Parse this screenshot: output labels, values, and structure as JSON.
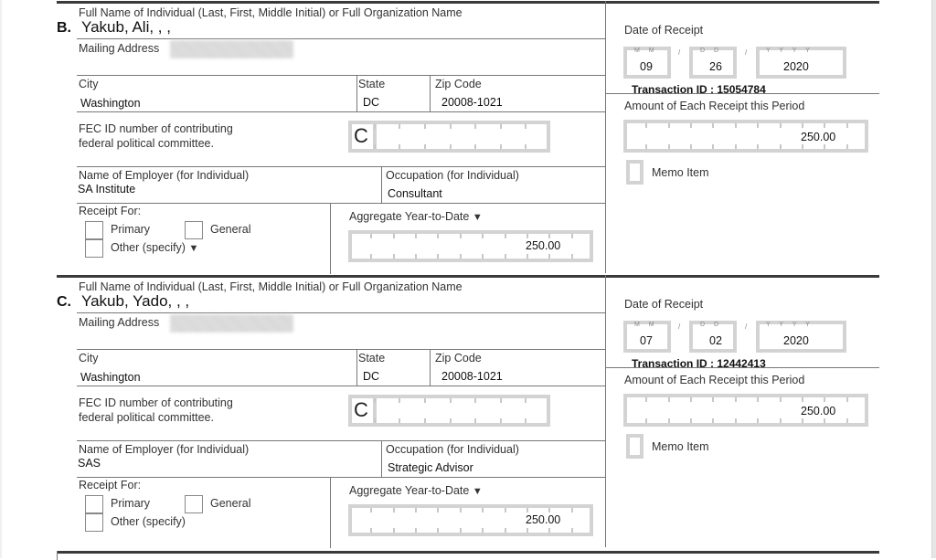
{
  "labels": {
    "full_name": "Full Name of Individual (Last, First, Middle Initial) or Full Organization Name",
    "mailing_address": "Mailing Address",
    "city": "City",
    "state": "State",
    "zip": "Zip Code",
    "fec_id_line1": "FEC ID number of contributing",
    "fec_id_line2": "federal political committee.",
    "fec_prefix": "C",
    "employer": "Name of Employer (for Individual)",
    "occupation": "Occupation (for Individual)",
    "receipt_for": "Receipt For:",
    "primary": "Primary",
    "general": "General",
    "other": "Other (specify)",
    "aggregate": "Aggregate Year-to-Date",
    "date_of_receipt": "Date of Receipt",
    "amount": "Amount of Each Receipt this Period",
    "memo_item": "Memo Item",
    "mm": "M M",
    "dd": "D D",
    "yyyy": "Y Y Y Y",
    "triangle": "▼"
  },
  "entries": [
    {
      "letter": "B.",
      "name": "Yakub, Ali, , ,",
      "mailing_address": "[redacted]",
      "city": "Washington",
      "state": "DC",
      "zip": "20008-1021",
      "employer": "SA Institute",
      "occupation": "Consultant",
      "aggregate": "250.00",
      "date": {
        "month": "09",
        "day": "26",
        "year": "2020"
      },
      "transaction_id": "Transaction ID : 15054784",
      "amount": "250.00",
      "other_has_triangle": true
    },
    {
      "letter": "C.",
      "name": "Yakub, Yado, , ,",
      "mailing_address": "[redacted]",
      "city": "Washington",
      "state": "DC",
      "zip": "20008-1021",
      "employer": "SAS",
      "occupation": "Strategic Advisor",
      "aggregate": "250.00",
      "date": {
        "month": "07",
        "day": "02",
        "year": "2020"
      },
      "transaction_id": "Transaction ID : 12442413",
      "amount": "250.00",
      "other_has_triangle": false
    }
  ]
}
